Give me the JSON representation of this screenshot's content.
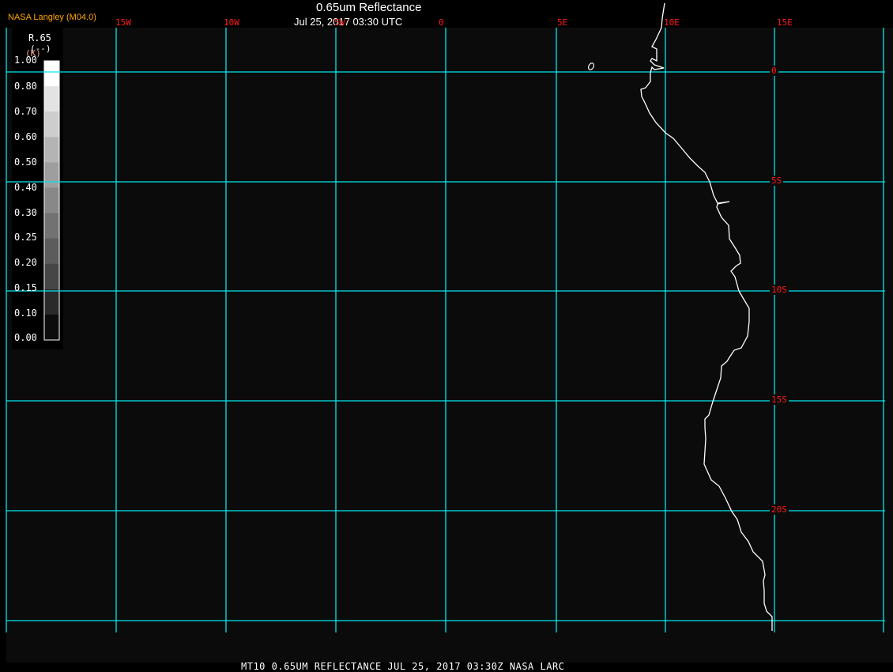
{
  "header": {
    "brand": "NASA Langley (M04.0)",
    "title": "0.65um Reflectance",
    "datetime": "Jul 25, 2017 03:30 UTC"
  },
  "map": {
    "longitude_labels": [
      "15W",
      "10W",
      "5W",
      "0",
      "5E",
      "10E",
      "15E"
    ],
    "latitude_labels": [
      "0",
      "5S",
      "10S",
      "15S",
      "20S"
    ],
    "grid_color": "#00e5ee",
    "label_color": "#ff1a1a",
    "coastline_color": "#ffffff",
    "background_color": "#0b0b0b"
  },
  "legend": {
    "variable": "R.65",
    "units": "(--)",
    "units_alt": "(K)",
    "ticks": [
      "1.00",
      "0.80",
      "0.70",
      "0.60",
      "0.50",
      "0.40",
      "0.30",
      "0.25",
      "0.20",
      "0.15",
      "0.10",
      "0.00"
    ],
    "colors": [
      "#ffffff",
      "#e3e3e3",
      "#cdcdcd",
      "#b4b4b4",
      "#9e9e9e",
      "#888888",
      "#727272",
      "#5c5c5c",
      "#464646",
      "#2a2a2a",
      "#0c0c0c"
    ]
  },
  "footer": {
    "caption": "MT10  0.65UM REFLECTANCE   JUL 25, 2017 03:30Z   NASA LARC"
  }
}
